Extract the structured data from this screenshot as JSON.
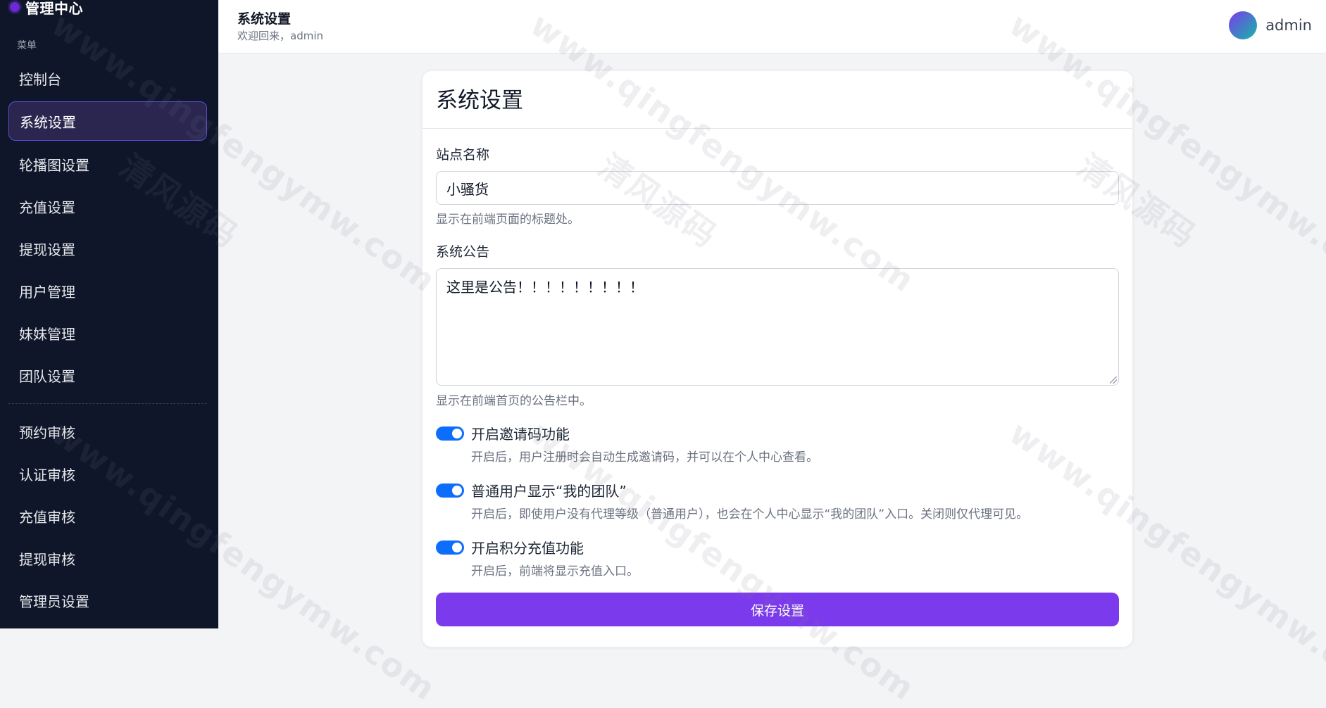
{
  "brand": {
    "title": "管理中心",
    "dot_color": "#6d28d9"
  },
  "sidebar": {
    "caption": "菜单",
    "items": [
      {
        "label": "控制台",
        "active": false
      },
      {
        "label": "系统设置",
        "active": true
      },
      {
        "label": "轮播图设置",
        "active": false
      },
      {
        "label": "充值设置",
        "active": false
      },
      {
        "label": "提现设置",
        "active": false
      },
      {
        "label": "用户管理",
        "active": false
      },
      {
        "label": "妹妹管理",
        "active": false
      },
      {
        "label": "团队设置",
        "active": false
      },
      {
        "label": "预约审核",
        "active": false
      },
      {
        "label": "认证审核",
        "active": false
      },
      {
        "label": "充值审核",
        "active": false
      },
      {
        "label": "提现审核",
        "active": false
      },
      {
        "label": "管理员设置",
        "active": false
      }
    ]
  },
  "header": {
    "title": "系统设置",
    "subtitle": "欢迎回来，admin",
    "username": "admin"
  },
  "form": {
    "title": "系统设置",
    "site_name": {
      "label": "站点名称",
      "value": "小骚货",
      "help": "显示在前端页面的标题处。"
    },
    "notice": {
      "label": "系统公告",
      "value": "这里是公告！！！！！！！！！",
      "help": "显示在前端首页的公告栏中。"
    },
    "toggles": [
      {
        "label": "开启邀请码功能",
        "enabled": true,
        "help": "开启后，用户注册时会自动生成邀请码，并可以在个人中心查看。"
      },
      {
        "label": "普通用户显示“我的团队”",
        "enabled": true,
        "help": "开启后，即使用户没有代理等级（普通用户），也会在个人中心显示“我的团队”入口。关闭则仅代理可见。"
      },
      {
        "label": "开启积分充值功能",
        "enabled": true,
        "help": "开启后，前端将显示充值入口。"
      }
    ],
    "save_label": "保存设置"
  },
  "watermark": {
    "text_url": "www.qingfengymw.com",
    "text_cn": "清风源码"
  },
  "colors": {
    "sidebar_bg": "#0f1629",
    "accent": "#7c3aed",
    "toggle_on": "#0d6efd"
  }
}
